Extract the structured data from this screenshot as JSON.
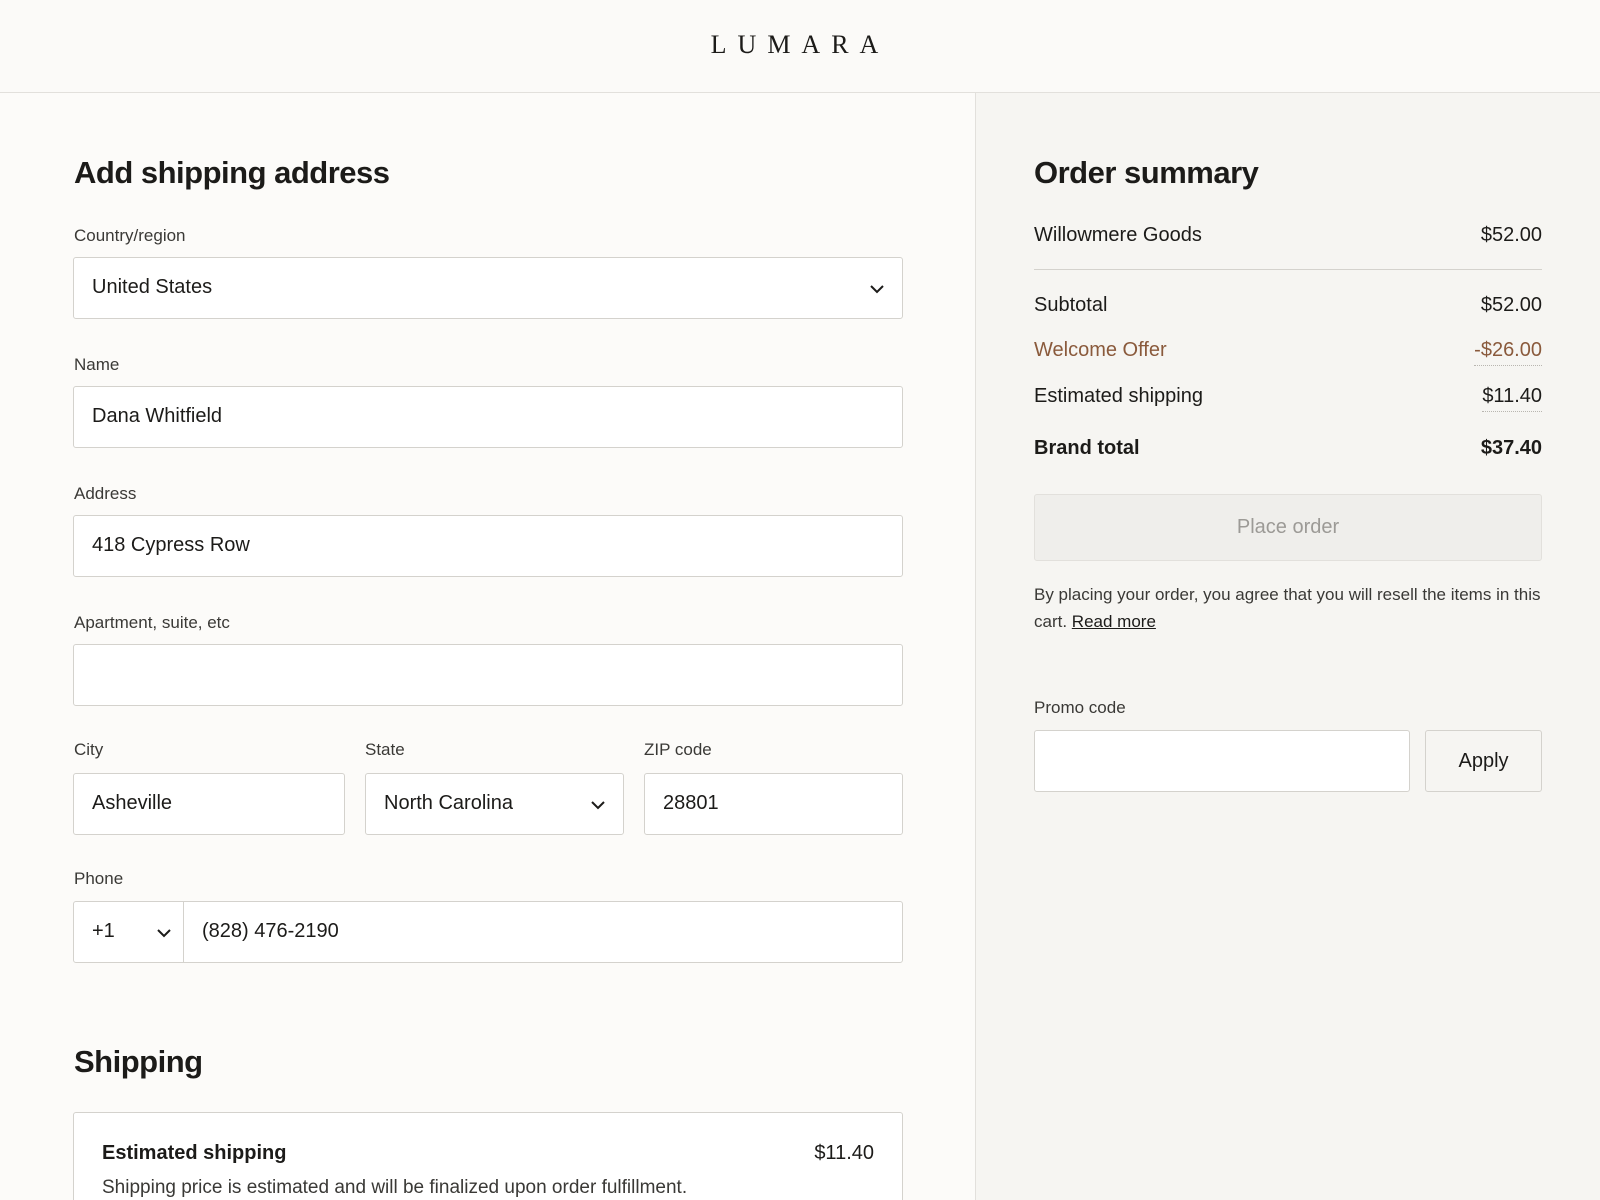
{
  "brand": "LUMARA",
  "address_form": {
    "title": "Add shipping address",
    "country": {
      "label": "Country/region",
      "value": "United States"
    },
    "name": {
      "label": "Name",
      "value": "Dana Whitfield"
    },
    "address": {
      "label": "Address",
      "value": "418 Cypress Row"
    },
    "apartment": {
      "label": "Apartment, suite, etc",
      "value": ""
    },
    "city": {
      "label": "City",
      "value": "Asheville"
    },
    "state": {
      "label": "State",
      "value": "North Carolina"
    },
    "zip": {
      "label": "ZIP code",
      "value": "28801"
    },
    "phone": {
      "label": "Phone",
      "country_code": "+1",
      "value": "(828) 476-2190"
    }
  },
  "shipping": {
    "title": "Shipping",
    "option_title": "Estimated shipping",
    "option_price": "$11.40",
    "option_note": "Shipping price is estimated and will be finalized upon order fulfillment."
  },
  "summary": {
    "title": "Order summary",
    "store_name": "Willowmere Goods",
    "store_amount": "$52.00",
    "subtotal_label": "Subtotal",
    "subtotal_value": "$52.00",
    "offer_label": "Welcome Offer",
    "offer_value": "-$26.00",
    "shipping_label": "Estimated shipping",
    "shipping_value": "$11.40",
    "total_label": "Brand total",
    "total_value": "$37.40",
    "place_order": "Place order",
    "legal_text": "By placing your order, you agree that you will resell the items in this cart.",
    "read_more": "Read more",
    "promo_label": "Promo code",
    "promo_value": "",
    "apply": "Apply"
  },
  "colors": {
    "offer": "#8a5a3c",
    "muted_button_text": "#9c9a96",
    "border": "#d4d2cd"
  },
  "icons": [
    "chevron-down-icon"
  ]
}
